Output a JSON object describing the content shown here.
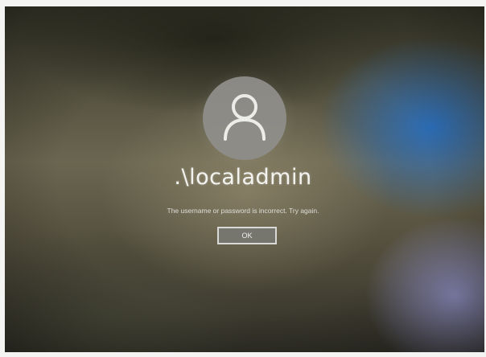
{
  "lock_screen": {
    "username": ".\\localadmin",
    "error_message": "The username or password is incorrect. Try again.",
    "ok_label": "OK",
    "avatar_icon": "user-icon"
  },
  "colors": {
    "avatar_background": "#8f8e8a",
    "accent_blue": "#286ebe",
    "text": "#f3f3f0"
  }
}
